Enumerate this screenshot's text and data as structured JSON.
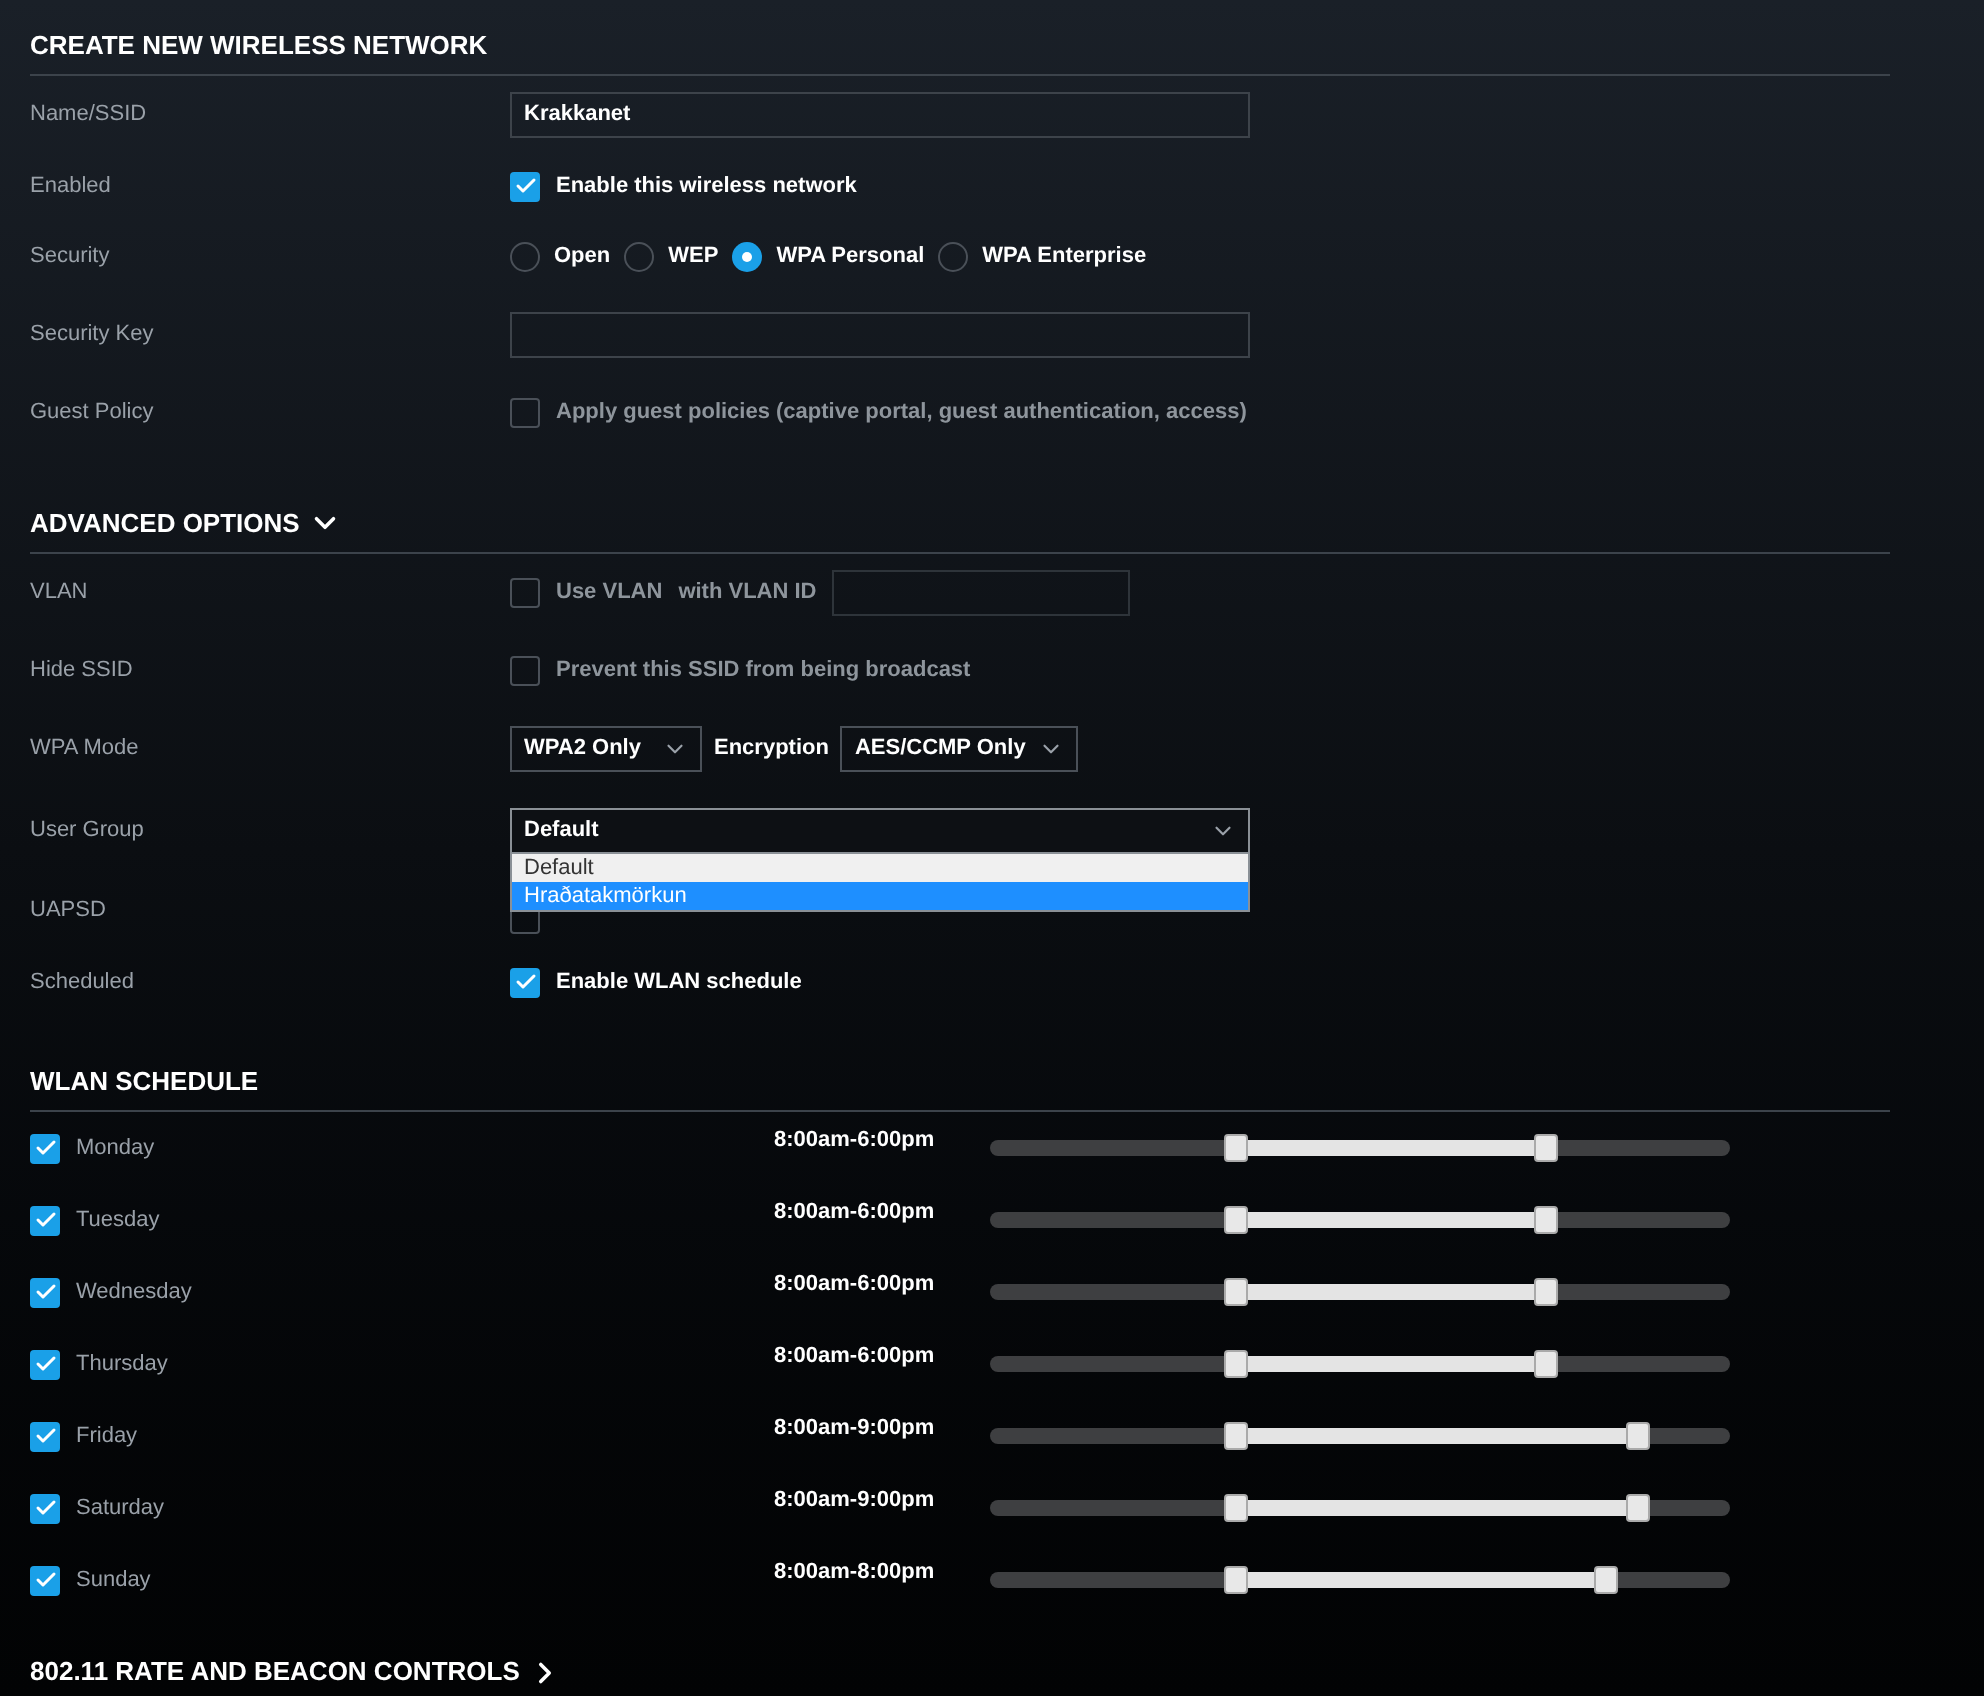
{
  "title": "CREATE NEW WIRELESS NETWORK",
  "basic": [
    {
      "kind": "text",
      "label": "Name/SSID",
      "value": "Krakkanet"
    },
    {
      "kind": "checkbox",
      "label": "Enabled",
      "checked": true,
      "text": "Enable this wireless network"
    },
    {
      "kind": "radio",
      "label": "Security",
      "options": [
        {
          "label": "Open",
          "selected": false
        },
        {
          "label": "WEP",
          "selected": false
        },
        {
          "label": "WPA Personal",
          "selected": true
        },
        {
          "label": "WPA Enterprise",
          "selected": false
        }
      ]
    },
    {
      "kind": "text",
      "label": "Security Key"
    },
    {
      "kind": "checkbox",
      "label": "Guest Policy",
      "checked": false,
      "text": "Apply guest policies (captive portal, guest authentication, access)"
    }
  ],
  "advanced": {
    "title": "ADVANCED OPTIONS",
    "expanded": true,
    "rows": [
      {
        "kind": "vlan",
        "label": "VLAN",
        "checked": false,
        "text": "Use VLAN",
        "suffix": "with VLAN ID"
      },
      {
        "kind": "checkbox",
        "label": "Hide SSID",
        "checked": false,
        "text": "Prevent this SSID from being broadcast"
      },
      {
        "kind": "selects",
        "label": "WPA Mode",
        "value": "WPA2 Only",
        "second_label": "Encryption",
        "second_value": "AES/CCMP Only"
      },
      {
        "kind": "dropdown",
        "label": "User Group",
        "value": "Default",
        "options": [
          {
            "label": "Default",
            "highlighted": false
          },
          {
            "label": "Hraðatakmörkun",
            "highlighted": true
          }
        ]
      },
      {
        "kind": "hidden",
        "label": "UAPSD",
        "checked": false
      },
      {
        "kind": "checkbox",
        "label": "Scheduled",
        "checked": true,
        "text": "Enable WLAN schedule"
      }
    ]
  },
  "schedule": {
    "title": "WLAN SCHEDULE",
    "days": [
      {
        "day": "Monday",
        "checked": true,
        "time": "8:00am-6:00pm",
        "from": {
          "level": 0.333
        },
        "to": {
          "level": 0.75
        }
      },
      {
        "day": "Tuesday",
        "checked": true,
        "time": "8:00am-6:00pm",
        "from": {
          "level": 0.333
        },
        "to": {
          "level": 0.75
        }
      },
      {
        "day": "Wednesday",
        "checked": true,
        "time": "8:00am-6:00pm",
        "from": {
          "level": 0.333
        },
        "to": {
          "level": 0.75
        }
      },
      {
        "day": "Thursday",
        "checked": true,
        "time": "8:00am-6:00pm",
        "from": {
          "level": 0.333
        },
        "to": {
          "level": 0.75
        }
      },
      {
        "day": "Friday",
        "checked": true,
        "time": "8:00am-9:00pm",
        "from": {
          "level": 0.333
        },
        "to": {
          "level": 0.875
        }
      },
      {
        "day": "Saturday",
        "checked": true,
        "time": "8:00am-9:00pm",
        "from": {
          "level": 0.333
        },
        "to": {
          "level": 0.875
        }
      },
      {
        "day": "Sunday",
        "checked": true,
        "time": "8:00am-8:00pm",
        "from": {
          "level": 0.333
        },
        "to": {
          "level": 0.833
        }
      }
    ]
  },
  "rate": {
    "title": "802.11 RATE AND BEACON CONTROLS",
    "expanded": false
  }
}
